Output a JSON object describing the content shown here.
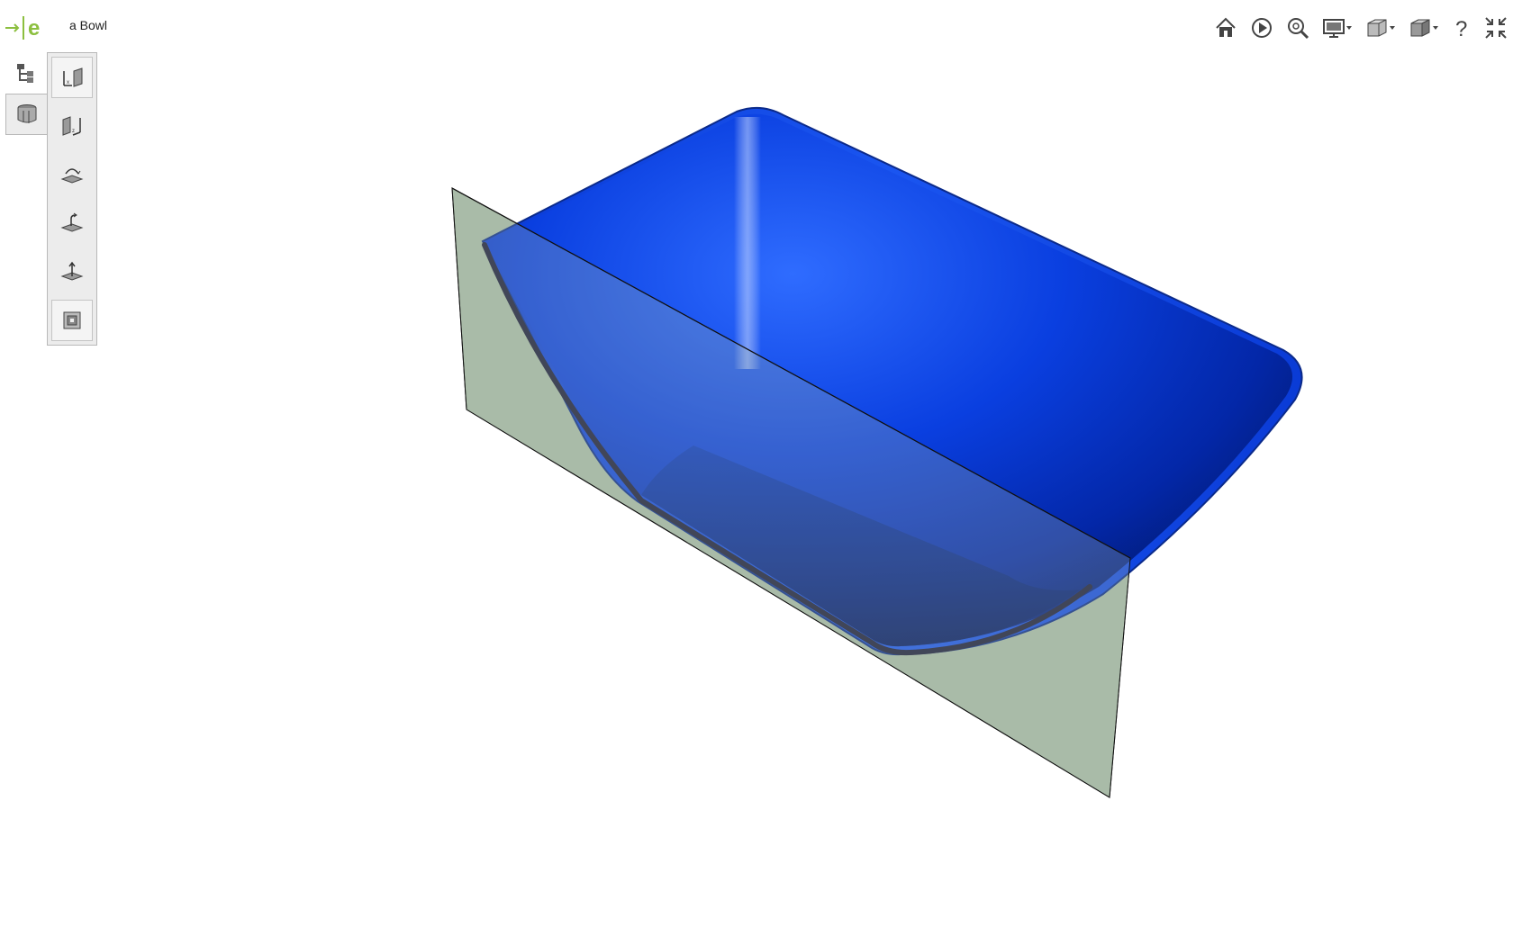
{
  "app": {
    "logo_text": "e",
    "document_title": "a Bowl"
  },
  "left_tabs": [
    {
      "name": "feature-tree-icon",
      "active": false
    },
    {
      "name": "part-display-icon",
      "active": true
    }
  ],
  "tools": [
    {
      "name": "xy-plane-view-icon"
    },
    {
      "name": "yz-plane-view-icon"
    },
    {
      "name": "rotate-about-plane-icon"
    },
    {
      "name": "plane-orientation-icon"
    },
    {
      "name": "normal-axis-icon"
    },
    {
      "name": "section-view-icon"
    }
  ],
  "toolbar": [
    {
      "name": "home-icon"
    },
    {
      "name": "play-animation-icon"
    },
    {
      "name": "zoom-fit-icon"
    },
    {
      "name": "display-mode-icon"
    },
    {
      "name": "view-orientation-icon"
    },
    {
      "name": "shading-style-icon"
    },
    {
      "name": "help-icon"
    },
    {
      "name": "exit-fullscreen-icon"
    }
  ],
  "model": {
    "name": "a Bowl",
    "body_color": "#0a36c9",
    "plane_color": "#a9bba8"
  }
}
